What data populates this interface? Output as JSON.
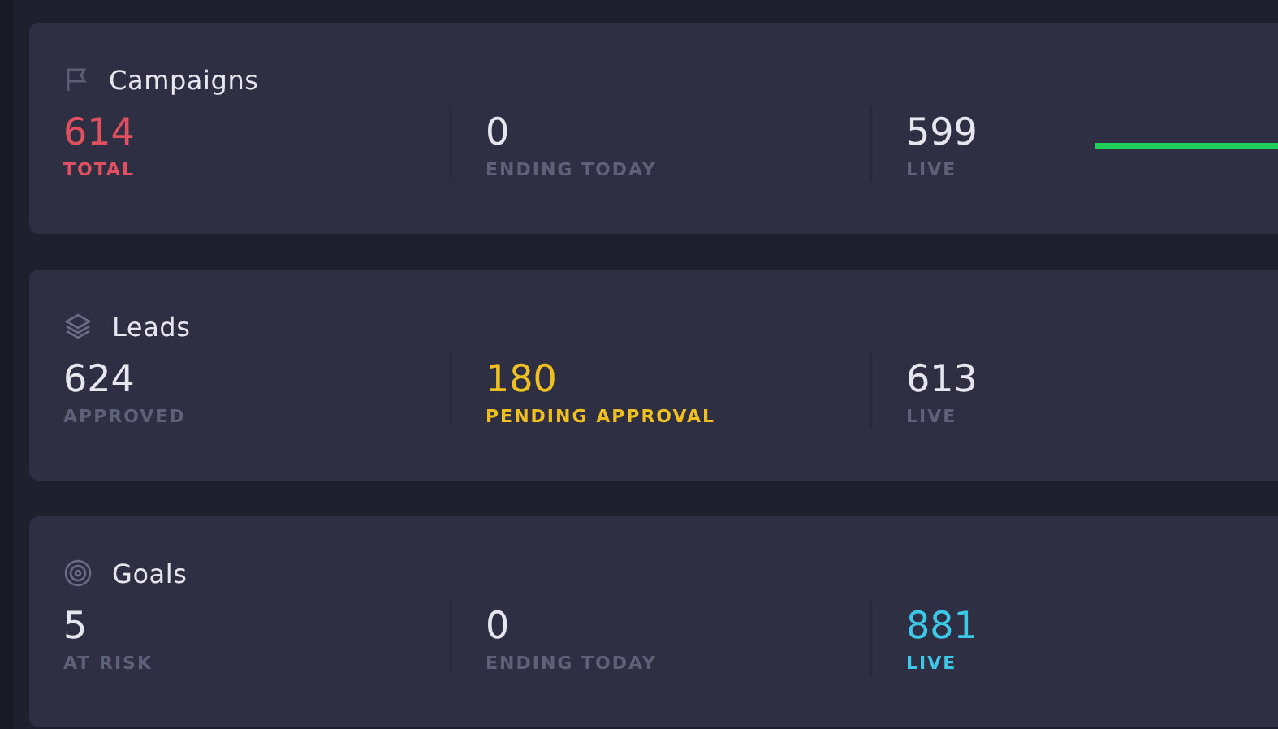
{
  "cards": [
    {
      "title": "Campaigns",
      "kind": "flag",
      "trend": true,
      "stats": [
        {
          "value": "614",
          "label": "TOTAL",
          "kind": "highlight",
          "color": "#e0505e"
        },
        {
          "value": "0",
          "label": "ENDING TODAY",
          "kind": "plain"
        },
        {
          "value": "599",
          "label": "LIVE",
          "kind": "plain"
        }
      ]
    },
    {
      "title": "Leads",
      "kind": "layers",
      "trend": false,
      "stats": [
        {
          "value": "624",
          "label": "APPROVED",
          "kind": "plain"
        },
        {
          "value": "180",
          "label": "PENDING APPROVAL",
          "kind": "highlight",
          "color": "#f0c020"
        },
        {
          "value": "613",
          "label": "LIVE",
          "kind": "plain"
        }
      ]
    },
    {
      "title": "Goals",
      "kind": "target",
      "trend": false,
      "stats": [
        {
          "value": "5",
          "label": "AT RISK",
          "kind": "plain"
        },
        {
          "value": "0",
          "label": "ENDING TODAY",
          "kind": "plain"
        },
        {
          "value": "881",
          "label": "LIVE",
          "kind": "highlight",
          "color": "#3ec8e8"
        }
      ]
    }
  ]
}
